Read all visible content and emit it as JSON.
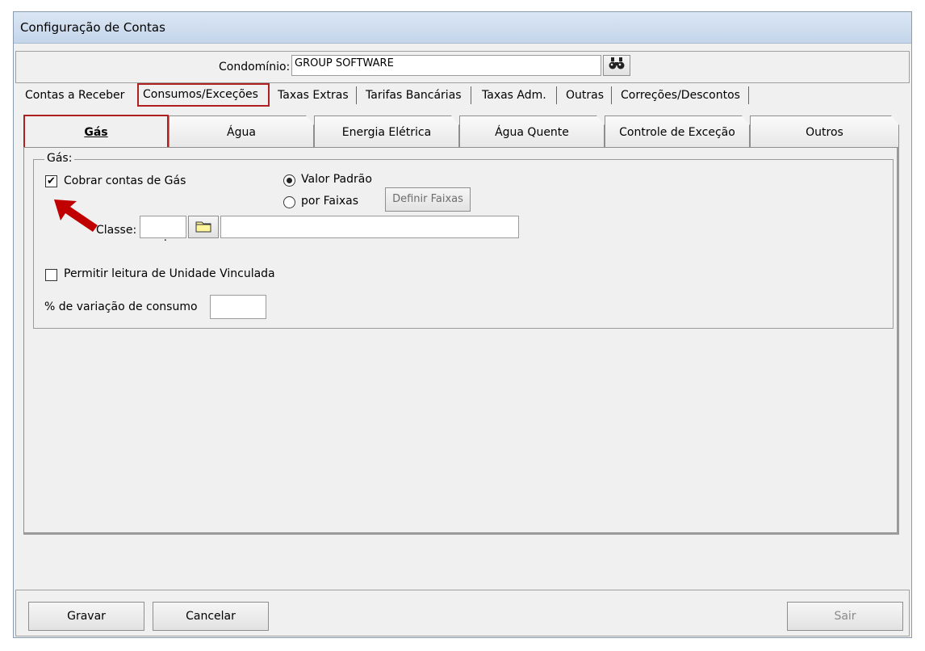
{
  "window": {
    "title": "Configuração de Contas"
  },
  "condominio": {
    "label": "Condomínio:",
    "value": "GROUP SOFTWARE",
    "search_icon": "binoculars-icon"
  },
  "main_tabs": [
    {
      "label": "Contas a Receber"
    },
    {
      "label": "Consumos/Exceções",
      "active": true
    },
    {
      "label": "Taxas Extras"
    },
    {
      "label": "Tarifas Bancárias"
    },
    {
      "label": "Taxas Adm."
    },
    {
      "label": "Outras"
    },
    {
      "label": "Correções/Descontos"
    }
  ],
  "sub_tabs": [
    {
      "label": "Gás",
      "active": true
    },
    {
      "label": "Água"
    },
    {
      "label": "Energia Elétrica"
    },
    {
      "label": "Água Quente"
    },
    {
      "label": "Controle de Exceção"
    },
    {
      "label": "Outros"
    }
  ],
  "gas_group": {
    "legend": "Gás:",
    "cobrar_label": "Cobrar contas de Gás",
    "cobrar_checked": true,
    "valor_padrao_label": "Valor Padrão",
    "por_faixas_label": "por Faixas",
    "definir_faixas_label": "Definir Faixas",
    "classe_label": "Classe:",
    "classe_code": "  .",
    "classe_desc": "",
    "permitir_label": "Permitir leitura de Unidade Vinculada",
    "permitir_checked": false,
    "variacao_label": "% de variação de consumo",
    "variacao_value": ""
  },
  "footer": {
    "gravar_label": "Gravar",
    "cancelar_label": "Cancelar",
    "sair_label": "Sair"
  },
  "colors": {
    "highlight": "#b02020",
    "arrow": "#c00000"
  }
}
